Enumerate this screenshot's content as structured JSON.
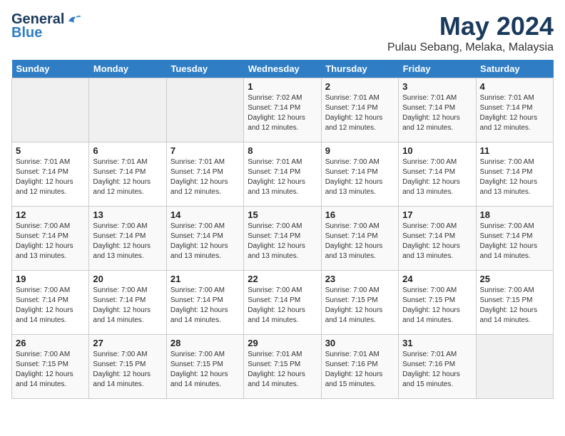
{
  "logo": {
    "general": "General",
    "blue": "Blue"
  },
  "title": {
    "month_year": "May 2024",
    "location": "Pulau Sebang, Melaka, Malaysia"
  },
  "headers": [
    "Sunday",
    "Monday",
    "Tuesday",
    "Wednesday",
    "Thursday",
    "Friday",
    "Saturday"
  ],
  "weeks": [
    [
      {
        "day": "",
        "info": ""
      },
      {
        "day": "",
        "info": ""
      },
      {
        "day": "",
        "info": ""
      },
      {
        "day": "1",
        "info": "Sunrise: 7:02 AM\nSunset: 7:14 PM\nDaylight: 12 hours\nand 12 minutes."
      },
      {
        "day": "2",
        "info": "Sunrise: 7:01 AM\nSunset: 7:14 PM\nDaylight: 12 hours\nand 12 minutes."
      },
      {
        "day": "3",
        "info": "Sunrise: 7:01 AM\nSunset: 7:14 PM\nDaylight: 12 hours\nand 12 minutes."
      },
      {
        "day": "4",
        "info": "Sunrise: 7:01 AM\nSunset: 7:14 PM\nDaylight: 12 hours\nand 12 minutes."
      }
    ],
    [
      {
        "day": "5",
        "info": "Sunrise: 7:01 AM\nSunset: 7:14 PM\nDaylight: 12 hours\nand 12 minutes."
      },
      {
        "day": "6",
        "info": "Sunrise: 7:01 AM\nSunset: 7:14 PM\nDaylight: 12 hours\nand 12 minutes."
      },
      {
        "day": "7",
        "info": "Sunrise: 7:01 AM\nSunset: 7:14 PM\nDaylight: 12 hours\nand 12 minutes."
      },
      {
        "day": "8",
        "info": "Sunrise: 7:01 AM\nSunset: 7:14 PM\nDaylight: 12 hours\nand 13 minutes."
      },
      {
        "day": "9",
        "info": "Sunrise: 7:00 AM\nSunset: 7:14 PM\nDaylight: 12 hours\nand 13 minutes."
      },
      {
        "day": "10",
        "info": "Sunrise: 7:00 AM\nSunset: 7:14 PM\nDaylight: 12 hours\nand 13 minutes."
      },
      {
        "day": "11",
        "info": "Sunrise: 7:00 AM\nSunset: 7:14 PM\nDaylight: 12 hours\nand 13 minutes."
      }
    ],
    [
      {
        "day": "12",
        "info": "Sunrise: 7:00 AM\nSunset: 7:14 PM\nDaylight: 12 hours\nand 13 minutes."
      },
      {
        "day": "13",
        "info": "Sunrise: 7:00 AM\nSunset: 7:14 PM\nDaylight: 12 hours\nand 13 minutes."
      },
      {
        "day": "14",
        "info": "Sunrise: 7:00 AM\nSunset: 7:14 PM\nDaylight: 12 hours\nand 13 minutes."
      },
      {
        "day": "15",
        "info": "Sunrise: 7:00 AM\nSunset: 7:14 PM\nDaylight: 12 hours\nand 13 minutes."
      },
      {
        "day": "16",
        "info": "Sunrise: 7:00 AM\nSunset: 7:14 PM\nDaylight: 12 hours\nand 13 minutes."
      },
      {
        "day": "17",
        "info": "Sunrise: 7:00 AM\nSunset: 7:14 PM\nDaylight: 12 hours\nand 13 minutes."
      },
      {
        "day": "18",
        "info": "Sunrise: 7:00 AM\nSunset: 7:14 PM\nDaylight: 12 hours\nand 14 minutes."
      }
    ],
    [
      {
        "day": "19",
        "info": "Sunrise: 7:00 AM\nSunset: 7:14 PM\nDaylight: 12 hours\nand 14 minutes."
      },
      {
        "day": "20",
        "info": "Sunrise: 7:00 AM\nSunset: 7:14 PM\nDaylight: 12 hours\nand 14 minutes."
      },
      {
        "day": "21",
        "info": "Sunrise: 7:00 AM\nSunset: 7:14 PM\nDaylight: 12 hours\nand 14 minutes."
      },
      {
        "day": "22",
        "info": "Sunrise: 7:00 AM\nSunset: 7:14 PM\nDaylight: 12 hours\nand 14 minutes."
      },
      {
        "day": "23",
        "info": "Sunrise: 7:00 AM\nSunset: 7:15 PM\nDaylight: 12 hours\nand 14 minutes."
      },
      {
        "day": "24",
        "info": "Sunrise: 7:00 AM\nSunset: 7:15 PM\nDaylight: 12 hours\nand 14 minutes."
      },
      {
        "day": "25",
        "info": "Sunrise: 7:00 AM\nSunset: 7:15 PM\nDaylight: 12 hours\nand 14 minutes."
      }
    ],
    [
      {
        "day": "26",
        "info": "Sunrise: 7:00 AM\nSunset: 7:15 PM\nDaylight: 12 hours\nand 14 minutes."
      },
      {
        "day": "27",
        "info": "Sunrise: 7:00 AM\nSunset: 7:15 PM\nDaylight: 12 hours\nand 14 minutes."
      },
      {
        "day": "28",
        "info": "Sunrise: 7:00 AM\nSunset: 7:15 PM\nDaylight: 12 hours\nand 14 minutes."
      },
      {
        "day": "29",
        "info": "Sunrise: 7:01 AM\nSunset: 7:15 PM\nDaylight: 12 hours\nand 14 minutes."
      },
      {
        "day": "30",
        "info": "Sunrise: 7:01 AM\nSunset: 7:16 PM\nDaylight: 12 hours\nand 15 minutes."
      },
      {
        "day": "31",
        "info": "Sunrise: 7:01 AM\nSunset: 7:16 PM\nDaylight: 12 hours\nand 15 minutes."
      },
      {
        "day": "",
        "info": ""
      }
    ]
  ]
}
